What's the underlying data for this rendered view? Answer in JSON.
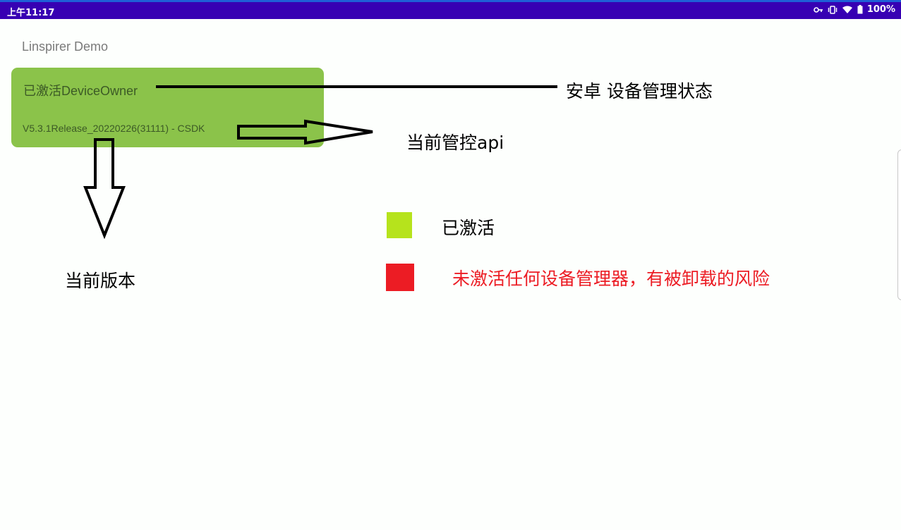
{
  "status_bar": {
    "time": "上午11:17",
    "battery": "100%",
    "icons": [
      "key-icon",
      "vibrate-icon",
      "wifi-icon",
      "battery-icon"
    ],
    "background": "#3700b3"
  },
  "app": {
    "title": "Linspirer Demo"
  },
  "card": {
    "status": "已激活DeviceOwner",
    "version": "V5.3.1Release_20220226(31111) - CSDK",
    "background": "#8bc34a"
  },
  "annotations": {
    "android_status": "安卓 设备管理状态",
    "api": "当前管控api",
    "version": "当前版本"
  },
  "legend": {
    "active": {
      "label": "已激活",
      "color": "#b6e31c"
    },
    "inactive": {
      "label": "未激活任何设备管理器，有被卸载的风险",
      "color": "#ec1c24"
    }
  }
}
